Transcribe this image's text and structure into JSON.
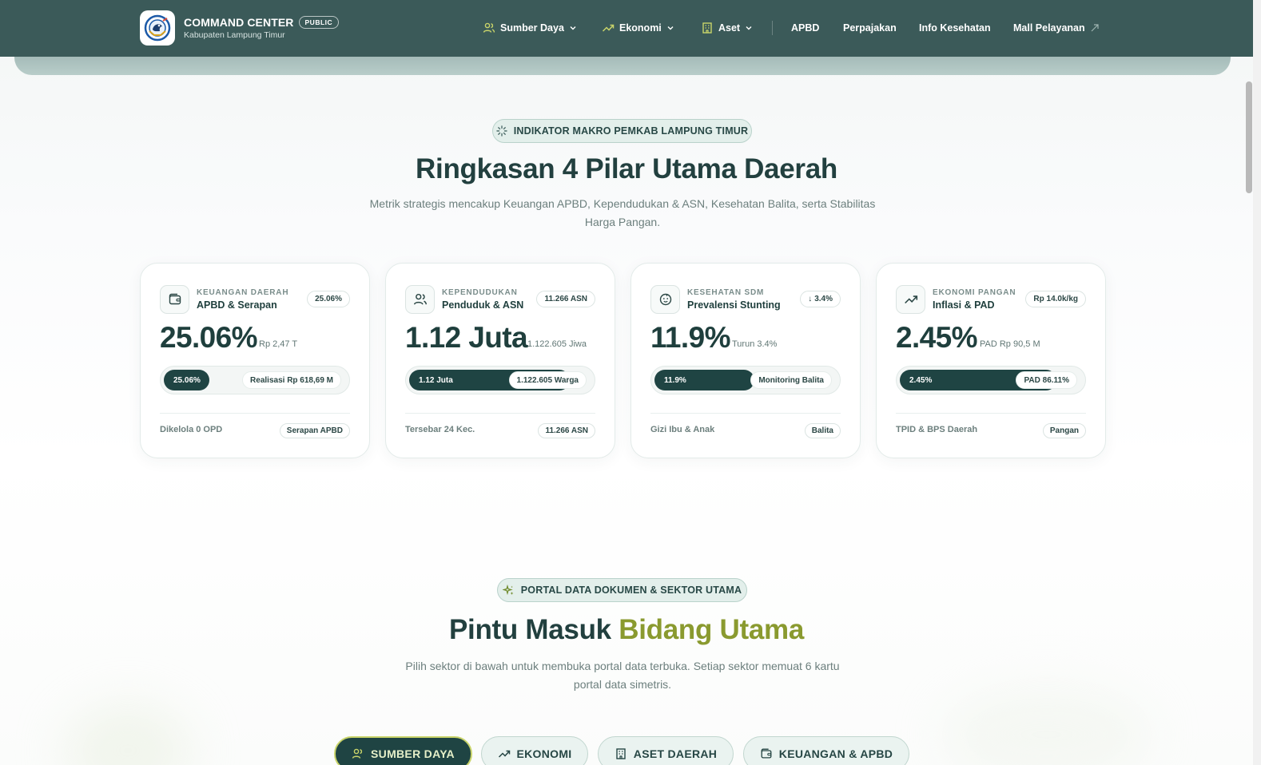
{
  "header": {
    "brand_title": "COMMAND CENTER",
    "brand_badge": "PUBLIC",
    "brand_sub": "Kabupaten Lampung Timur",
    "nav": [
      {
        "label": "Sumber Daya",
        "icon": "users-icon",
        "dropdown": true
      },
      {
        "label": "Ekonomi",
        "icon": "trend-up-icon",
        "dropdown": true
      },
      {
        "label": "Aset",
        "icon": "building-icon",
        "dropdown": true
      },
      {
        "label": "APBD"
      },
      {
        "label": "Perpajakan"
      },
      {
        "label": "Info Kesehatan"
      },
      {
        "label": "Mall Pelayanan",
        "icon": "external-link-icon"
      }
    ]
  },
  "macro": {
    "pill": "INDIKATOR MAKRO PEMKAB LAMPUNG TIMUR",
    "title": "Ringkasan 4 Pilar Utama Daerah",
    "description": "Metrik strategis mencakup Keuangan APBD, Kependudukan & ASN, Kesehatan Balita, serta Stabilitas Harga Pangan."
  },
  "cards": [
    {
      "icon": "wallet-icon",
      "category": "KEUANGAN DAERAH",
      "name": "APBD & Serapan",
      "badge": "25.06%",
      "value": "25.06%",
      "value_sub": "Rp 2,47 T",
      "bar_fill_label": "25.06%",
      "bar_right_label": "Realisasi Rp 618,69 M",
      "bar_fill_fraction": 0.25,
      "foot": "Dikelola 0 OPD",
      "foot_badge": "Serapan APBD"
    },
    {
      "icon": "users-icon",
      "category": "KEPENDUDUKAN",
      "name": "Penduduk & ASN",
      "badge": "11.266 ASN",
      "value": "1.12 Juta",
      "value_sub": "1.122.605 Jiwa",
      "bar_fill_label": "1.12 Juta",
      "bar_right_label": "1.122.605 Warga",
      "bar_fill_fraction": 0.88,
      "foot": "Tersebar 24 Kec.",
      "foot_badge": "11.266 ASN"
    },
    {
      "icon": "baby-icon",
      "category": "KESEHATAN SDM",
      "name": "Prevalensi Stunting",
      "badge": "3.4%",
      "badge_arrow": "↓",
      "value": "11.9%",
      "value_sub": "Turun 3.4%",
      "bar_fill_label": "11.9%",
      "bar_right_label": "Monitoring Balita",
      "bar_fill_fraction": 0.55,
      "foot": "Gizi Ibu & Anak",
      "foot_badge": "Balita"
    },
    {
      "icon": "trend-up-icon",
      "category": "EKONOMI PANGAN",
      "name": "Inflasi & PAD",
      "badge": "Rp 14.0k/kg",
      "value": "2.45%",
      "value_sub": "PAD Rp 90,5 M",
      "bar_fill_label": "2.45%",
      "bar_right_label": "PAD 86.11%",
      "bar_fill_fraction": 0.86,
      "foot": "TPID & BPS Daerah",
      "foot_badge": "Pangan"
    }
  ],
  "portal": {
    "pill": "PORTAL DATA DOKUMEN & SEKTOR UTAMA",
    "title_main": "Pintu Masuk",
    "title_accent": "Bidang Utama",
    "description": "Pilih sektor di bawah untuk membuka portal data terbuka. Setiap sektor memuat 6 kartu portal data simetris.",
    "tabs": [
      {
        "label": "SUMBER DAYA",
        "icon": "users-icon",
        "active": true
      },
      {
        "label": "EKONOMI",
        "icon": "trend-up-icon",
        "active": false
      },
      {
        "label": "ASET DAERAH",
        "icon": "building-icon",
        "active": false
      },
      {
        "label": "KEUANGAN & APBD",
        "icon": "wallet-icon",
        "active": false
      }
    ]
  },
  "colors": {
    "header_bg": "#3b5a59",
    "primary_dark": "#1f4443",
    "accent_olive": "#8a9a2f",
    "icon_olive": "#c9d46a"
  }
}
